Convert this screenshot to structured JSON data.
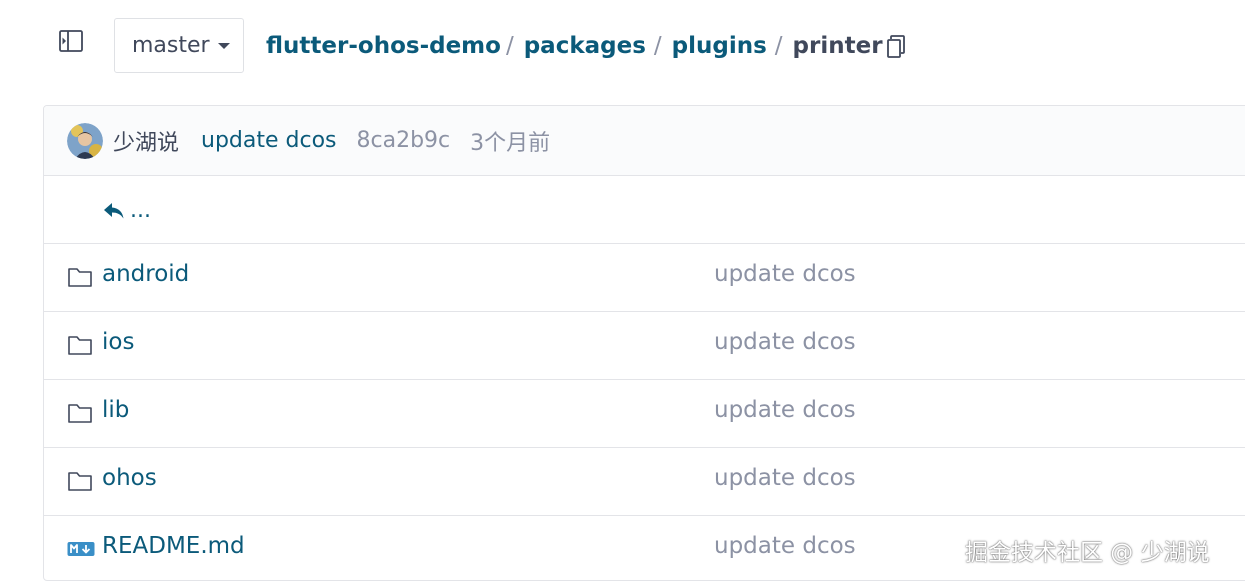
{
  "header": {
    "branch": "master",
    "breadcrumb": {
      "repo": "flutter-ohos-demo",
      "sep1": "/",
      "seg1": "packages",
      "sep2": "/",
      "seg2": "plugins",
      "sep3": "/",
      "current": "printer"
    },
    "icons": {
      "sidebar_toggle": "sidebar-toggle-icon",
      "branch_caret": "caret-down-icon",
      "copy": "copy-icon"
    }
  },
  "commit": {
    "author": "少湖说",
    "message": "update dcos",
    "hash": "8ca2b9c",
    "time": "3个月前"
  },
  "back": {
    "label": "...",
    "icon": "reply-arrow-icon"
  },
  "files": [
    {
      "name": "android",
      "type": "folder",
      "icon": "folder-icon",
      "commit_message": "update dcos"
    },
    {
      "name": "ios",
      "type": "folder",
      "icon": "folder-icon",
      "commit_message": "update dcos"
    },
    {
      "name": "lib",
      "type": "folder",
      "icon": "folder-icon",
      "commit_message": "update dcos"
    },
    {
      "name": "ohos",
      "type": "folder",
      "icon": "folder-icon",
      "commit_message": "update dcos"
    },
    {
      "name": "README.md",
      "type": "file",
      "icon": "markdown-file-icon",
      "commit_message": "update dcos"
    }
  ],
  "watermark": "掘金技术社区 @ 少湖说",
  "colors": {
    "link": "#0b5a7a",
    "text": "#40485b",
    "muted": "#8c92a4",
    "border": "#e3e4e8",
    "commit_bar_bg": "#fafbfc",
    "markdown_icon": "#3a8fc7"
  }
}
